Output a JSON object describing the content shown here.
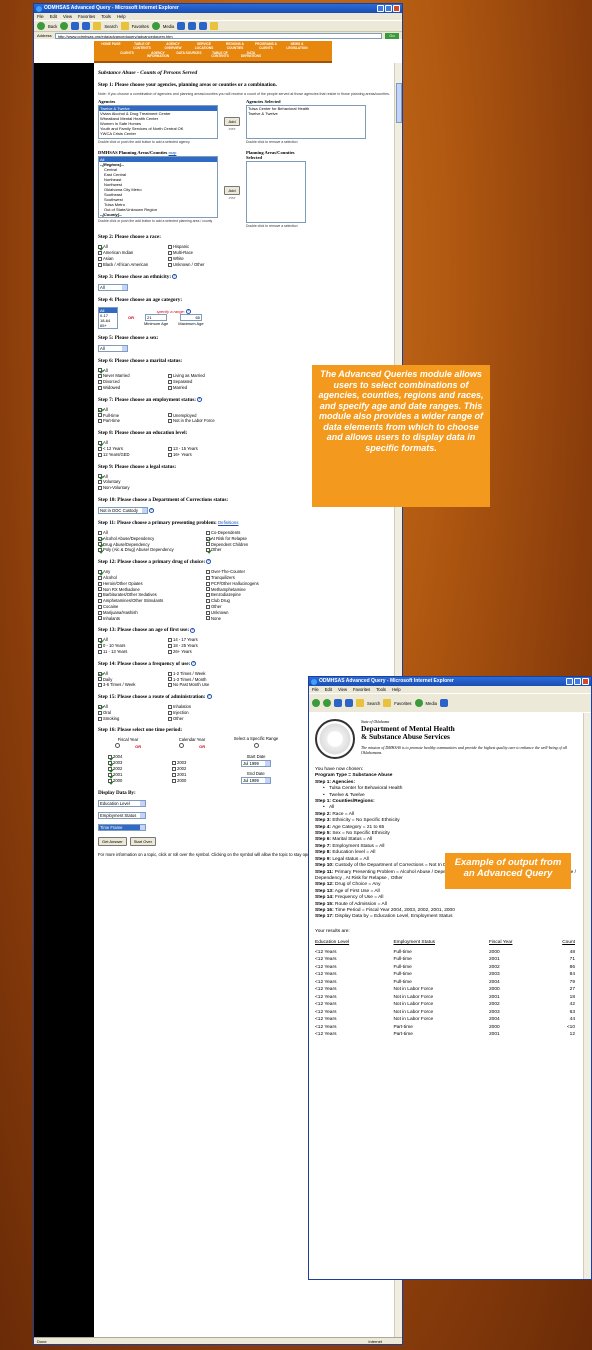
{
  "main_window": {
    "title": "ODMHSAS Advanced Query - Microsoft Internet Explorer",
    "menu": [
      "File",
      "Edit",
      "View",
      "Favorites",
      "Tools",
      "Help"
    ],
    "toolbar": {
      "back": "Back",
      "search": "Search",
      "favorites": "Favorites",
      "media": "Media"
    },
    "address_label": "Address",
    "address_value": "http://www.odmhsas.org/eda/advancedquery/advancedquery.htm",
    "go_label": "Go",
    "links_label": "Links",
    "status": "Done",
    "zone": "Internet"
  },
  "nav": [
    "HOME PAGE",
    "TABLE OF CONTENTS",
    "AGENCY OVERVIEW",
    "SERVICE LOCATIONS",
    "REGIONS & COUNTIES",
    "PROGRAMS & CLIENTS",
    "NEWS & LEGISLATION",
    "CLIENTS",
    "AGENCY INFORMATION",
    "DATA SOURCES",
    "TABLE OF CONTENTS",
    "DATA DEFINITIONS"
  ],
  "page": {
    "title": "Substance Abuse - Counts of Persons Served",
    "step1": {
      "heading": "Step 1: Please choose your agencies, planning areas or counties or a combination.",
      "note": "Note: If you choose a combination of agencies and planning areas/counties you will receive a count of the people served at those agencies that reside in those planning areas/counties.",
      "agencies_label": "Agencies",
      "agencies": [
        "Twelve & Twelve",
        "Vivian Alcohol & Drug Treatment Center",
        "Wheatland Mental Health Center",
        "Women in Safe Homes",
        "Youth and Family Services of North Central OK",
        "YWCA Crisis Center"
      ],
      "agencies_selected_label": "Agencies Selected",
      "agencies_selected": [
        "Tulsa Center for Behavioral Health",
        "Twelve & Twelve"
      ],
      "add_label": "Add",
      "arrows": ">>>",
      "hint_add": "Double click or push the add button to add a selected agency",
      "hint_remove": "Double click to remove a selection",
      "areas_label": "DMHSAS Planning Areas/Counties",
      "map_link": "map",
      "areas": [
        "All",
        "--[Regions]--",
        "Central",
        "East Central",
        "Northeast",
        "Northwest",
        "Oklahoma City Metro",
        "Southeast",
        "Southwest",
        "Tulsa Metro",
        "Out of State/Unknown Region",
        "--[County]--"
      ],
      "areas_selected_label": "Planning Areas/Counties Selected",
      "hint_add_area": "Double click or push the add button to add a selected planning area / county"
    },
    "step2": {
      "heading": "Step 2: Please choose a race:",
      "options": [
        "All",
        "Hispanic",
        "American Indian",
        "Multi-Race",
        "Asian",
        "White",
        "Black / African American",
        "Unknown / Other"
      ]
    },
    "step3": {
      "heading": "Step 3: Please chose an ethnicity:",
      "value": "All"
    },
    "step4": {
      "heading": "Step 4: Please choose an age category:",
      "options": [
        "All",
        "0-17",
        "18-64",
        "65+"
      ],
      "or": "OR",
      "range_label": "specify a range:",
      "min": "21",
      "max": "65",
      "min_label": "Minimum Age",
      "max_label": "Maximum Age"
    },
    "step5": {
      "heading": "Step 5: Please choose a sex:",
      "value": "All"
    },
    "step6": {
      "heading": "Step 6: Please choose a marital status:",
      "options": [
        "All",
        "",
        "Never Married",
        "Living as Married",
        "Divorced",
        "Separated",
        "Widowed",
        "Married"
      ]
    },
    "step7": {
      "heading": "Step 7: Please choose an employment status:",
      "options": [
        "All",
        "",
        "Full-time",
        "Unemployed",
        "Part-time",
        "Not in the Labor Force"
      ]
    },
    "step8": {
      "heading": "Step 8: Please choose an education level:",
      "options": [
        "All",
        "",
        "< 12 Years",
        "13 - 15 Years",
        "12 Years/GED",
        "16+ Years"
      ]
    },
    "step9": {
      "heading": "Step 9: Please choose a legal status:",
      "options": [
        "All",
        "Voluntary",
        "Non-Voluntary"
      ]
    },
    "step10": {
      "heading": "Step 10: Please choose a Department of Corrections status:",
      "value": "Not in DOC Custody"
    },
    "step11": {
      "heading": "Step 11: Please choose a primary presenting problem:",
      "link": "Definitions",
      "options": [
        "All",
        "Co-Dependents",
        "Alcohol Abuse/Dependency",
        "At Risk for Relapse",
        "Drug Abuse/Dependency",
        "Dependent Children",
        "Poly (Alc & Drug) Abuse/ Dependency",
        "Other"
      ]
    },
    "step12": {
      "heading": "Step 12: Please choose a primary drug of choice:",
      "options": [
        "Any",
        "Over-The-Counter",
        "Alcohol",
        "Tranquilizers",
        "Heroin/Other Opiates",
        "PCP/Other Hallucinogens",
        "Non RX Methadone",
        "Methamphetamine",
        "Barbiturates/Other Sedatives",
        "Benzodiazepine",
        "Amphetamines/Other Stimulants",
        "Club Drug",
        "Cocaine",
        "Other",
        "Marijuana/Hashish",
        "Unknown",
        "Inhalants",
        "None"
      ]
    },
    "step13": {
      "heading": "Step 13: Please choose an age of first use:",
      "options": [
        "All",
        "14 - 17 Years",
        "0 - 10 Years",
        "18 - 25 Years",
        "11 - 13 Years",
        "26+ Years"
      ]
    },
    "step14": {
      "heading": "Step 14: Please choose a frequency of use:",
      "options": [
        "All",
        "1-2 Times / Week",
        "Daily",
        "1-3 Times / Month",
        "3-6 Times / Week",
        "No Past Month Use"
      ]
    },
    "step15": {
      "heading": "Step 15: Please choose a route of administration:",
      "options": [
        "All",
        "Inhalation",
        "Oral",
        "Injection",
        "Smoking",
        "Other"
      ]
    },
    "step16": {
      "heading": "Step 16: Please select one time period:",
      "fiscal_label": "Fiscal Year",
      "calendar_label": "Calendar Year",
      "specific_label": "Select a Specific Range",
      "or": "OR",
      "fiscal_years": [
        "2004",
        "2003",
        "2002",
        "2001",
        "2000"
      ],
      "calendar_years": [
        "2003",
        "2002",
        "2001",
        "2000"
      ],
      "start_label": "Start Date",
      "start_value": "Jul 1999",
      "end_label": "End Date",
      "end_value": "Jul 1999"
    },
    "display": {
      "heading": "Display Data By:",
      "selects": [
        "Education Level",
        "Employment Status",
        "Time Frame"
      ]
    },
    "get_answer": "Get Answer",
    "start_over": "Start Over",
    "footer": "For more information on a topic, click or roll over the symbol. Clicking on the symbol will allow the topic to stay open."
  },
  "callout_main": "The Advanced Queries module allows users to select combinations of agencies, counties, regions and races, and specify age and date ranges. This module also provides a wider range of data elements from which to choose and allows users to display data in specific formats.",
  "callout_output": "Example of output from an Advanced Query",
  "output_window": {
    "title": "ODMHSAS Advanced Query - Microsoft Internet Explorer",
    "menu": [
      "File",
      "Edit",
      "View",
      "Favorites",
      "Tools",
      "Help"
    ],
    "state_of": "State of Oklahoma",
    "agency_line1": "Department of Mental Health",
    "agency_line2": "& Substance Abuse Services",
    "mission": "The mission of DMHSAS is to promote healthy communities and provide the highest quality care to enhance the well-being of all Oklahomans.",
    "intro": "You have now chosen:",
    "program": "Program Type = Substance Abuse",
    "step1": "Step 1: Agencies:",
    "agencies": [
      "Tulsa Center for Behavioral Health",
      "Twelve & Twelve"
    ],
    "step1b": "Step 1: Counties/Regions:",
    "regions": [
      "All"
    ],
    "lines": [
      [
        "Step 2:",
        "Race = All"
      ],
      [
        "Step 3:",
        "Ethnicity = No Specific Ethnicity"
      ],
      [
        "Step 4:",
        "Age Category = 21 to 65"
      ],
      [
        "Step 5:",
        "Sex = No Specific Ethnicity"
      ],
      [
        "Step 6:",
        "Marital Status = All"
      ],
      [
        "Step 7:",
        "Employment Status = All"
      ],
      [
        "Step 8:",
        "Education level = All"
      ],
      [
        "Step 9:",
        "Legal status = All"
      ],
      [
        "Step 10:",
        "Custody of the Department of Corrections = Not In DOC Custody"
      ],
      [
        "Step 11:",
        "Primary Presenting Problem = Alcohol Abuse / Dependency, Drug Abuse / Dependency, Poly (Alc & Drug) Abuse / Dependency , At Risk for Relapse , Other"
      ],
      [
        "Step 12:",
        "Drug of Choice = Any"
      ],
      [
        "Step 13:",
        "Age of First Use = All"
      ],
      [
        "Step 14:",
        "Frequency of Use = All"
      ],
      [
        "Step 15:",
        "Route of Admission = All"
      ],
      [
        "Step 16:",
        "Time Period = Fiscal Year 2004, 2003, 2002, 2001, 2000"
      ],
      [
        "Step 17:",
        "Display Data by = Education Level, Employment Status"
      ]
    ],
    "results_label": "Your results are:",
    "table_headers": [
      "Education Level",
      "Employment Status",
      "Fiscal Year",
      "Count"
    ],
    "rows": [
      [
        "<12 Years",
        "Full-time",
        "2000",
        "48"
      ],
      [
        "<12 Years",
        "Full-time",
        "2001",
        "71"
      ],
      [
        "<12 Years",
        "Full-time",
        "2002",
        "86"
      ],
      [
        "<12 Years",
        "Full-time",
        "2003",
        "84"
      ],
      [
        "<12 Years",
        "Full-time",
        "2004",
        "79"
      ],
      [
        "<12 Years",
        "Not in Labor Force",
        "2000",
        "27"
      ],
      [
        "<12 Years",
        "Not in Labor Force",
        "2001",
        "18"
      ],
      [
        "<12 Years",
        "Not in Labor Force",
        "2002",
        "42"
      ],
      [
        "<12 Years",
        "Not in Labor Force",
        "2003",
        "63"
      ],
      [
        "<12 Years",
        "Not in Labor Force",
        "2004",
        "44"
      ],
      [
        "<12 Years",
        "Part-time",
        "2000",
        "<10"
      ],
      [
        "<12 Years",
        "Part-time",
        "2001",
        "12"
      ]
    ]
  }
}
